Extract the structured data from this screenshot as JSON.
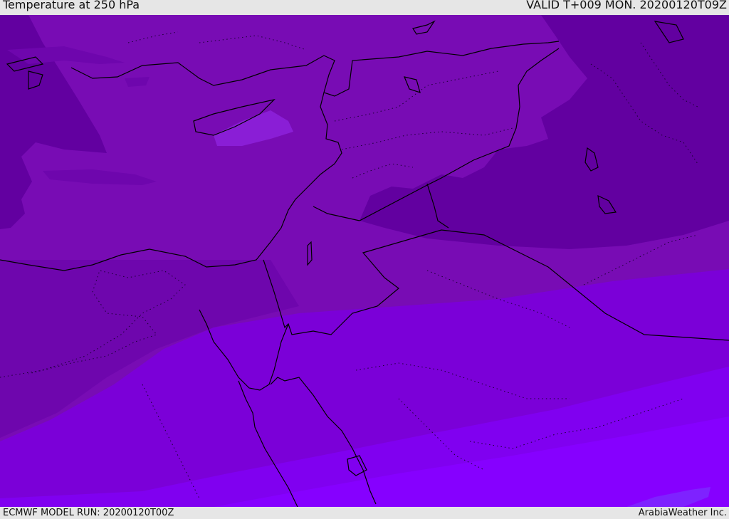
{
  "header": {
    "title": "Temperature at 250 hPa",
    "valid_time": "VALID T+009 MON. 20200120T09Z"
  },
  "footer": {
    "model_run": "ECMWF MODEL RUN: 20200120T00Z",
    "credit": "ArabiaWeather Inc."
  },
  "palette": {
    "band_coldest": "#6200a0",
    "band_cold": "#6e06ad",
    "band_mid": "#780cb4",
    "band_warm": "#7b00d8",
    "band_warmer": "#8000f0",
    "band_warmest": "#8600ff",
    "coast_line": "#000000"
  }
}
